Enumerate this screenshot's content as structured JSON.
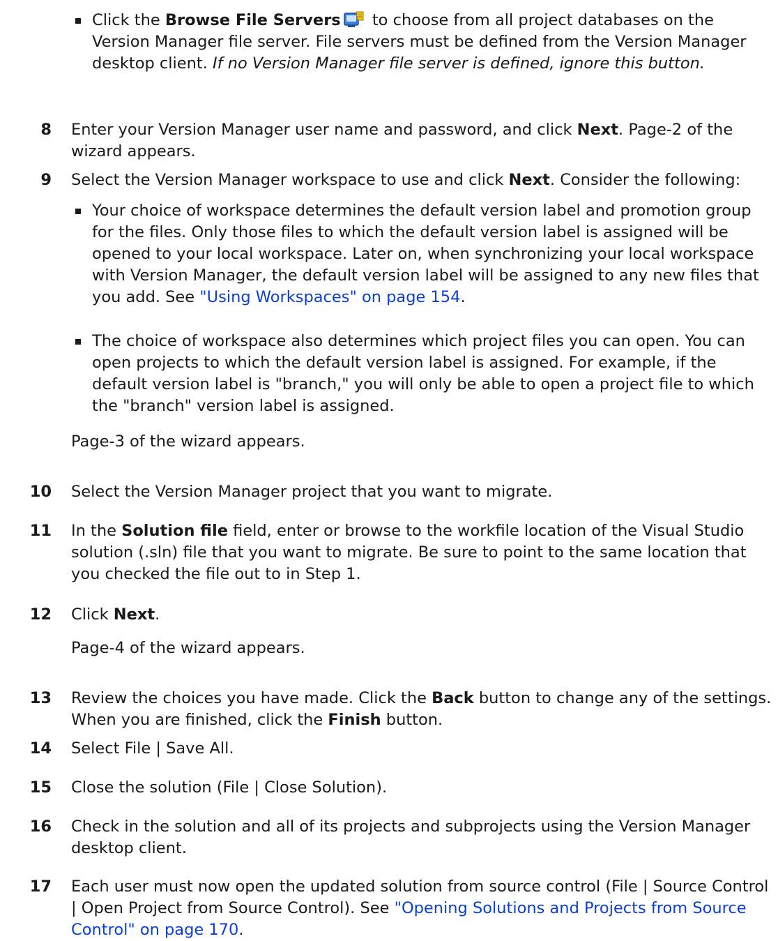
{
  "bullet_browse": {
    "pre": "Click the ",
    "button_label": "Browse File Servers",
    "post_icon": " to choose from all project databases on the Version Manager file server. File servers must be defined from the Version Manager desktop client. ",
    "italic": "If no Version Manager file server is defined, ignore this button.",
    "icon": "browse-file-servers-icon"
  },
  "step8": {
    "num": "8",
    "pre": "Enter your Version Manager user name and password, and click ",
    "bold": "Next",
    "post": ". Page-2 of the wizard appears."
  },
  "step9": {
    "num": "9",
    "pre": "Select the Version Manager workspace to use and click ",
    "bold": "Next",
    "post": ". Consider the following:"
  },
  "bullet_workspace": {
    "text": "Your choice of workspace determines the default version label and promotion group for the files. Only those files to which the default version label is assigned will be opened to your local workspace. Later on, when synchronizing your local workspace with Version Manager, the default version label will be assigned to any new files that you add. See ",
    "link": "\"Using Workspaces\" on page 154",
    "post": "."
  },
  "bullet_choice": {
    "text": "The choice of workspace also determines which project files you can open. You can open projects to which the default version label is assigned. For example, if the default version label is \"branch,\" you will only be able to open a project file to which the \"branch\" version label is assigned."
  },
  "page3": "Page-3 of the wizard appears.",
  "step10": {
    "num": "10",
    "text": "Select the Version Manager project that you want to migrate."
  },
  "step11": {
    "num": "11",
    "pre": "In the ",
    "bold": "Solution file",
    "post": " field, enter or browse to the workfile location of the Visual Studio solution (.sln) file that you want to migrate. Be sure to point to the same location that you checked the file out to in Step 1."
  },
  "step12": {
    "num": "12",
    "pre": "Click ",
    "bold": "Next",
    "post": "."
  },
  "page4": "Page-4 of the wizard appears.",
  "step13": {
    "num": "13",
    "pre": "Review the choices you have made. Click the ",
    "bold1": "Back",
    "mid": " button to change any of the settings. When you are finished, click the ",
    "bold2": "Finish",
    "post": " button."
  },
  "step14": {
    "num": "14",
    "text": "Select File | Save All."
  },
  "step15": {
    "num": "15",
    "text": "Close the solution (File | Close Solution)."
  },
  "step16": {
    "num": "16",
    "text": "Check in the solution and all of its projects and subprojects using the Version Manager desktop client."
  },
  "step17": {
    "num": "17",
    "text": "Each user must now open the updated solution from source control (File | Source Control | Open Project from Source Control). See ",
    "link": "\"Opening Solutions and Projects from Source Control\" on page 170",
    "post": "."
  },
  "colors": {
    "text": "#1a1a1a",
    "link": "#0b3fd6",
    "icon_blue": "#3a7fd6",
    "icon_yellow": "#f0c020"
  }
}
